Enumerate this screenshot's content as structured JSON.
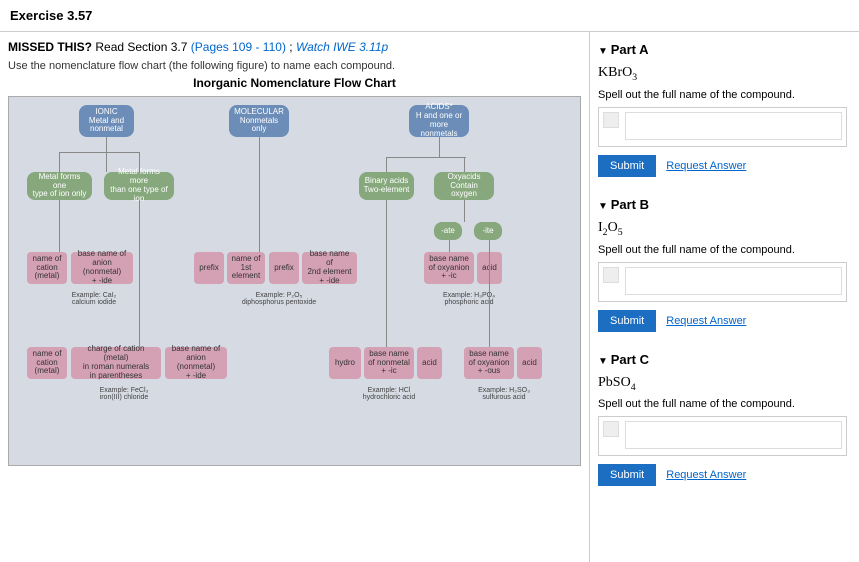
{
  "header": "Exercise 3.57",
  "missed": {
    "prefix": "MISSED THIS?",
    "read": "Read Section 3.7",
    "pages": "(Pages 109 - 110)",
    "sep": ";",
    "watch": "Watch IWE 3.11p"
  },
  "instruction": "Use the nomenclature flow chart (the following figure) to name each compound.",
  "chart_title": "Inorganic Nomenclature Flow Chart",
  "nodes": {
    "ionic": "IONIC\nMetal and\nnonmetal",
    "molecular": "MOLECULAR\nNonmetals\nonly",
    "acids": "ACIDS*\nH and one or\nmore nonmetals",
    "metal_one": "Metal forms one\ntype of ion only",
    "metal_more": "Metal forms more\nthan one type of ion",
    "binary": "Binary acids\nTwo-element",
    "oxyacids": "Oxyacids\nContain oxygen",
    "ate": "-ate",
    "ite": "-ite",
    "cation1": "name of\ncation\n(metal)",
    "anion1": "base name of\nanion (nonmetal)\n+ -ide",
    "prefix1": "prefix",
    "first": "name of\n1st\nelement",
    "prefix2": "prefix",
    "second": "base name of\n2nd element\n+ -ide",
    "oxy1": "base name\nof oxyanion\n+ -ic",
    "acid1": "acid",
    "cation2": "name of\ncation\n(metal)",
    "charge": "charge of cation (metal)\nin roman numerals\nin parentheses",
    "anion2": "base name of\nanion (nonmetal)\n+ -ide",
    "hydro": "hydro",
    "nonmetal": "base name\nof nonmetal\n+ -ic",
    "acid2": "acid",
    "oxy2": "base name\nof oxyanion\n+ -ous",
    "acid3": "acid"
  },
  "examples": {
    "ex1": "Example: CaI₂\ncalcium iodide",
    "ex2": "Example: P₂O₅\ndiphosphorus pentoxide",
    "ex3": "Example: H₃PO₄\nphosphoric acid",
    "ex4": "Example: FeCl₃\niron(III) chloride",
    "ex5": "Example: HCl\nhydrochloric acid",
    "ex6": "Example: H₂SO₃\nsulfurous acid"
  },
  "parts": {
    "a": {
      "label": "Part A",
      "formula": "KBrO₃",
      "spell": "Spell out the full name of the compound."
    },
    "b": {
      "label": "Part B",
      "formula": "I₂O₅",
      "spell": "Spell out the full name of the compound."
    },
    "c": {
      "label": "Part C",
      "formula": "PbSO₄",
      "spell": "Spell out the full name of the compound."
    }
  },
  "buttons": {
    "submit": "Submit",
    "request": "Request Answer"
  }
}
